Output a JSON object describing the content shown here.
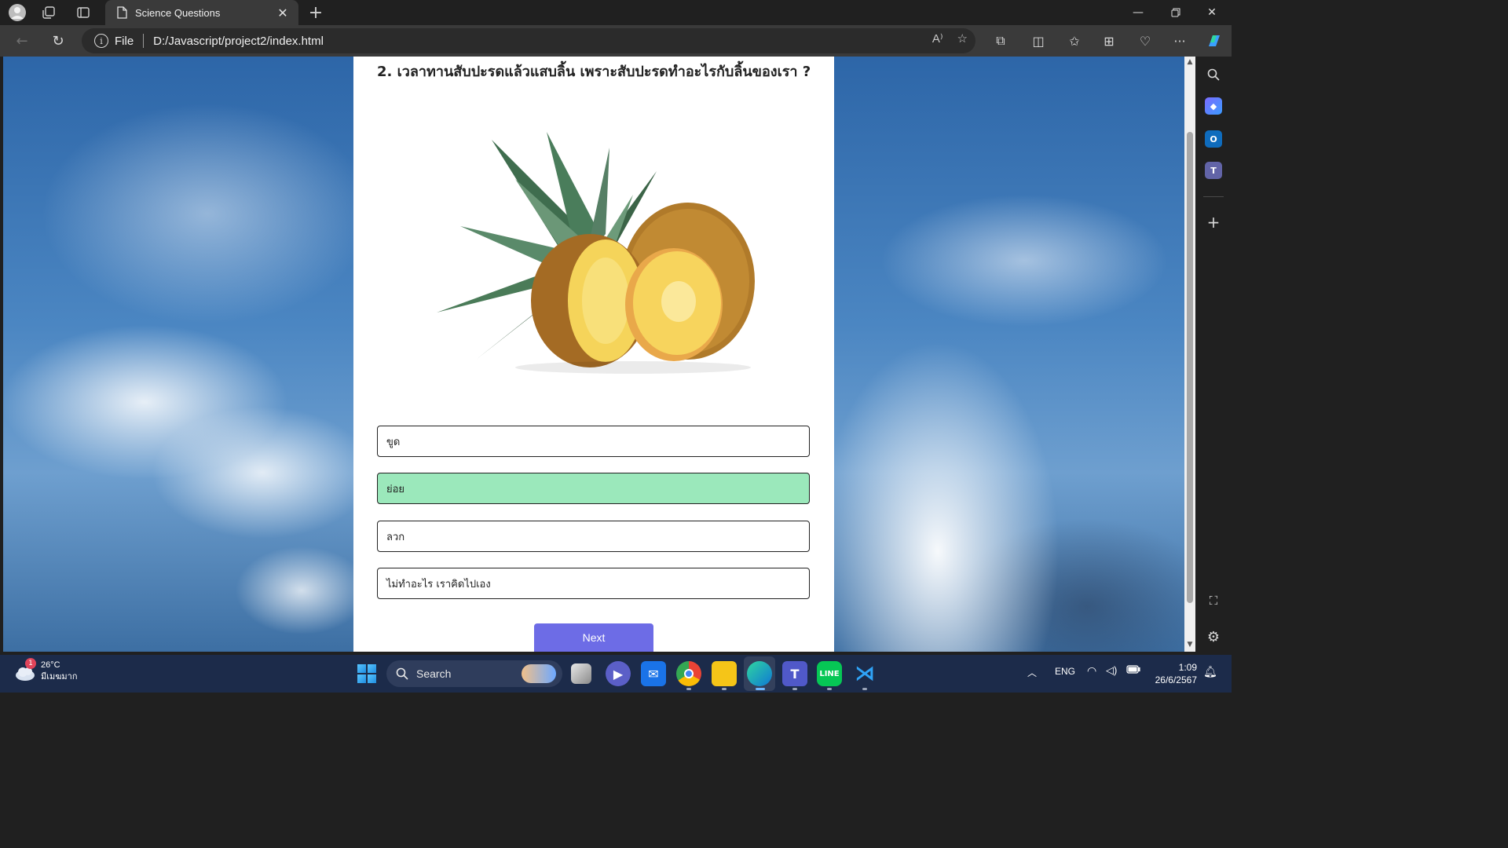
{
  "browser": {
    "tab_title": "Science Questions",
    "address_scheme": "File",
    "address_url": "D:/Javascript/project2/index.html"
  },
  "quiz": {
    "question": "2. เวลาทานสับปะรดแล้วแสบลิ้น เพราะสับปะรดทำอะไรกับลิ้นของเรา ?",
    "image": "pineapple",
    "answers": [
      {
        "label": "ขูด",
        "state": "default"
      },
      {
        "label": "ย่อย",
        "state": "correct"
      },
      {
        "label": "ลวก",
        "state": "default"
      },
      {
        "label": "ไม่ทำอะไร เราคิดไปเอง",
        "state": "default"
      }
    ],
    "next_label": "Next",
    "correct_color": "#9be8bb",
    "button_color": "#6d6ce6"
  },
  "taskbar": {
    "weather_badge": "1",
    "temperature": "26°C",
    "weather_desc": "มีเมฆมาก",
    "search_label": "Search",
    "lang": "ENG",
    "time": "1:09",
    "date": "26/6/2567"
  }
}
